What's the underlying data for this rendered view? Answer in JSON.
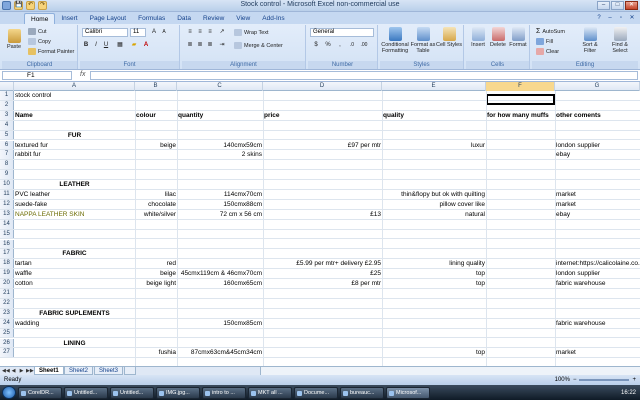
{
  "title": "Stock control - Microsoft Excel non-commercial use",
  "qat": [
    "💾",
    "↶",
    "↷"
  ],
  "tabs": [
    "Home",
    "Insert",
    "Page Layout",
    "Formulas",
    "Data",
    "Review",
    "View",
    "Add-Ins"
  ],
  "ribbon": {
    "clipboard": {
      "paste": "Paste",
      "cut": "Cut",
      "copy": "Copy",
      "format_painter": "Format Painter",
      "label": "Clipboard"
    },
    "font": {
      "name": "Calibri",
      "size": "11",
      "label": "Font"
    },
    "alignment": {
      "wrap": "Wrap Text",
      "merge": "Merge & Center",
      "label": "Alignment"
    },
    "number": {
      "format": "General",
      "label": "Number"
    },
    "styles": {
      "cond": "Conditional Formatting",
      "table": "Format as Table",
      "cell": "Cell Styles",
      "label": "Styles"
    },
    "cells": {
      "insert": "Insert",
      "delete": "Delete",
      "format": "Format",
      "label": "Cells"
    },
    "editing": {
      "autosum": "AutoSum",
      "fill": "Fill",
      "clear": "Clear",
      "sort": "Sort & Filter",
      "find": "Find & Select",
      "label": "Editing"
    }
  },
  "formula_bar": {
    "cell_ref": "F1",
    "fx": "fx",
    "value": ""
  },
  "columns": [
    "A",
    "B",
    "C",
    "D",
    "E",
    "F",
    "G"
  ],
  "selected_cell": "F1",
  "rows": [
    {
      "n": "1",
      "a": "stock control"
    },
    {
      "n": "2"
    },
    {
      "n": "3",
      "a": "Name",
      "b": "colour",
      "c": "quantity",
      "d": "price",
      "e": "quality",
      "f": "for how many muffs",
      "g": "other coments",
      "bold": true
    },
    {
      "n": "4"
    },
    {
      "n": "5",
      "a": "FUR",
      "section": true
    },
    {
      "n": "6",
      "a": "textured fur",
      "b": "beige",
      "c": "140cmx59cm",
      "d": "£97 per mtr",
      "e": "luxur",
      "g": "london supplier"
    },
    {
      "n": "7",
      "a": "rabbit fur",
      "c": "2 skins",
      "g": "ebay"
    },
    {
      "n": "8"
    },
    {
      "n": "9"
    },
    {
      "n": "10",
      "a": "LEATHER",
      "section": true
    },
    {
      "n": "11",
      "a": "PVC leather",
      "b": "lilac",
      "c": "114cmx70cm",
      "e": "thin&flopy but ok with quilting",
      "g": "market"
    },
    {
      "n": "12",
      "a": "suede-fake",
      "b": "chocolate",
      "c": "150cmx88cm",
      "e": "pillow cover like",
      "g": "market"
    },
    {
      "n": "13",
      "a": "NAPPA LEATHER SKIN",
      "b": "white/silver",
      "c": "72 cm x 56 cm",
      "d": "£13",
      "e": "natural",
      "g": "ebay",
      "olive": true
    },
    {
      "n": "14"
    },
    {
      "n": "15"
    },
    {
      "n": "16"
    },
    {
      "n": "17",
      "a": "FABRIC",
      "section": true
    },
    {
      "n": "18",
      "a": "tartan",
      "b": "red",
      "d": "£5.99 per mtr+ delivery £2.95",
      "e": "lining quality",
      "g": "internet:https://calicolaine.co.uk"
    },
    {
      "n": "19",
      "a": "waffle",
      "b": "beige",
      "c": "45cmx119cm & 46cmx70cm",
      "d": "£25",
      "e": "top",
      "g": "london supplier"
    },
    {
      "n": "20",
      "a": "cotton",
      "b": "beige light",
      "c": "160cmx65cm",
      "d": "£8 per mtr",
      "e": "top",
      "g": "fabric warehouse"
    },
    {
      "n": "21"
    },
    {
      "n": "22"
    },
    {
      "n": "23",
      "a": "FABRIC SUPLEMENTS",
      "section": true
    },
    {
      "n": "24",
      "a": "wadding",
      "c": "150cmx85cm",
      "g": "fabric warehouse"
    },
    {
      "n": "25"
    },
    {
      "n": "26",
      "a": "LINING",
      "section": true
    },
    {
      "n": "27",
      "b": "fushia",
      "c": "87cmx63cm&45cm34cm",
      "e": "top",
      "g": "market"
    }
  ],
  "sheets": [
    "Sheet1",
    "Sheet2",
    "Sheet3"
  ],
  "status": {
    "text": "Ready",
    "zoom": "100%"
  },
  "taskbar": {
    "items": [
      "CorelDR...",
      "Untitled...",
      "Untitled...",
      "IMG.jpg...",
      "intro to ...",
      "MKT all ...",
      "Docume...",
      "bureauc...",
      "Microsof..."
    ],
    "clock": "16:22"
  }
}
